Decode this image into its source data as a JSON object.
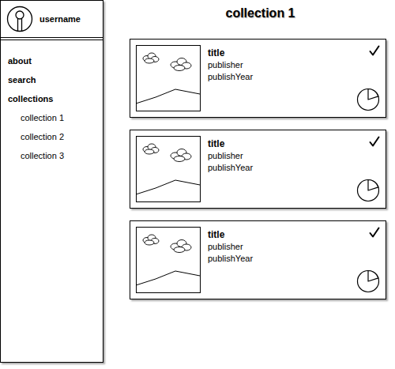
{
  "user": {
    "name": "username"
  },
  "nav": {
    "items": [
      {
        "label": "about"
      },
      {
        "label": "search"
      },
      {
        "label": "collections"
      }
    ],
    "collections": [
      {
        "label": "collection 1"
      },
      {
        "label": "collection 2"
      },
      {
        "label": "collection 3"
      }
    ]
  },
  "page": {
    "title": "collection 1"
  },
  "cards": [
    {
      "title": "title",
      "publisher": "publisher",
      "publishYear": "publishYear",
      "checked": true,
      "level": 0.2
    },
    {
      "title": "title",
      "publisher": "publisher",
      "publishYear": "publishYear",
      "checked": true,
      "level": 0.2
    },
    {
      "title": "title",
      "publisher": "publisher",
      "publishYear": "publishYear",
      "checked": true,
      "level": 0.2
    }
  ]
}
